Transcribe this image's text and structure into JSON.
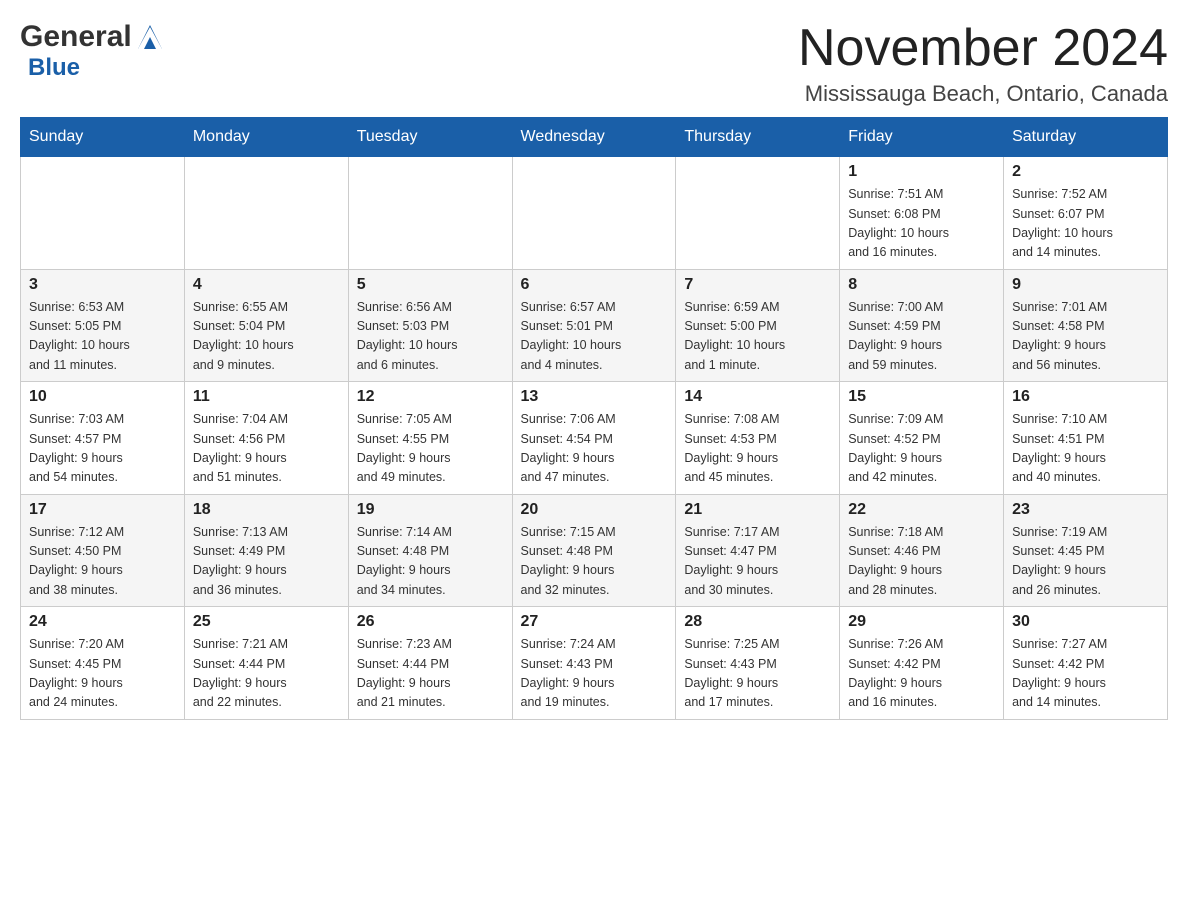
{
  "header": {
    "logo_general": "General",
    "logo_blue": "Blue",
    "month_title": "November 2024",
    "location": "Mississauga Beach, Ontario, Canada"
  },
  "days_of_week": [
    "Sunday",
    "Monday",
    "Tuesday",
    "Wednesday",
    "Thursday",
    "Friday",
    "Saturday"
  ],
  "weeks": [
    [
      {
        "day": "",
        "info": ""
      },
      {
        "day": "",
        "info": ""
      },
      {
        "day": "",
        "info": ""
      },
      {
        "day": "",
        "info": ""
      },
      {
        "day": "",
        "info": ""
      },
      {
        "day": "1",
        "info": "Sunrise: 7:51 AM\nSunset: 6:08 PM\nDaylight: 10 hours\nand 16 minutes."
      },
      {
        "day": "2",
        "info": "Sunrise: 7:52 AM\nSunset: 6:07 PM\nDaylight: 10 hours\nand 14 minutes."
      }
    ],
    [
      {
        "day": "3",
        "info": "Sunrise: 6:53 AM\nSunset: 5:05 PM\nDaylight: 10 hours\nand 11 minutes."
      },
      {
        "day": "4",
        "info": "Sunrise: 6:55 AM\nSunset: 5:04 PM\nDaylight: 10 hours\nand 9 minutes."
      },
      {
        "day": "5",
        "info": "Sunrise: 6:56 AM\nSunset: 5:03 PM\nDaylight: 10 hours\nand 6 minutes."
      },
      {
        "day": "6",
        "info": "Sunrise: 6:57 AM\nSunset: 5:01 PM\nDaylight: 10 hours\nand 4 minutes."
      },
      {
        "day": "7",
        "info": "Sunrise: 6:59 AM\nSunset: 5:00 PM\nDaylight: 10 hours\nand 1 minute."
      },
      {
        "day": "8",
        "info": "Sunrise: 7:00 AM\nSunset: 4:59 PM\nDaylight: 9 hours\nand 59 minutes."
      },
      {
        "day": "9",
        "info": "Sunrise: 7:01 AM\nSunset: 4:58 PM\nDaylight: 9 hours\nand 56 minutes."
      }
    ],
    [
      {
        "day": "10",
        "info": "Sunrise: 7:03 AM\nSunset: 4:57 PM\nDaylight: 9 hours\nand 54 minutes."
      },
      {
        "day": "11",
        "info": "Sunrise: 7:04 AM\nSunset: 4:56 PM\nDaylight: 9 hours\nand 51 minutes."
      },
      {
        "day": "12",
        "info": "Sunrise: 7:05 AM\nSunset: 4:55 PM\nDaylight: 9 hours\nand 49 minutes."
      },
      {
        "day": "13",
        "info": "Sunrise: 7:06 AM\nSunset: 4:54 PM\nDaylight: 9 hours\nand 47 minutes."
      },
      {
        "day": "14",
        "info": "Sunrise: 7:08 AM\nSunset: 4:53 PM\nDaylight: 9 hours\nand 45 minutes."
      },
      {
        "day": "15",
        "info": "Sunrise: 7:09 AM\nSunset: 4:52 PM\nDaylight: 9 hours\nand 42 minutes."
      },
      {
        "day": "16",
        "info": "Sunrise: 7:10 AM\nSunset: 4:51 PM\nDaylight: 9 hours\nand 40 minutes."
      }
    ],
    [
      {
        "day": "17",
        "info": "Sunrise: 7:12 AM\nSunset: 4:50 PM\nDaylight: 9 hours\nand 38 minutes."
      },
      {
        "day": "18",
        "info": "Sunrise: 7:13 AM\nSunset: 4:49 PM\nDaylight: 9 hours\nand 36 minutes."
      },
      {
        "day": "19",
        "info": "Sunrise: 7:14 AM\nSunset: 4:48 PM\nDaylight: 9 hours\nand 34 minutes."
      },
      {
        "day": "20",
        "info": "Sunrise: 7:15 AM\nSunset: 4:48 PM\nDaylight: 9 hours\nand 32 minutes."
      },
      {
        "day": "21",
        "info": "Sunrise: 7:17 AM\nSunset: 4:47 PM\nDaylight: 9 hours\nand 30 minutes."
      },
      {
        "day": "22",
        "info": "Sunrise: 7:18 AM\nSunset: 4:46 PM\nDaylight: 9 hours\nand 28 minutes."
      },
      {
        "day": "23",
        "info": "Sunrise: 7:19 AM\nSunset: 4:45 PM\nDaylight: 9 hours\nand 26 minutes."
      }
    ],
    [
      {
        "day": "24",
        "info": "Sunrise: 7:20 AM\nSunset: 4:45 PM\nDaylight: 9 hours\nand 24 minutes."
      },
      {
        "day": "25",
        "info": "Sunrise: 7:21 AM\nSunset: 4:44 PM\nDaylight: 9 hours\nand 22 minutes."
      },
      {
        "day": "26",
        "info": "Sunrise: 7:23 AM\nSunset: 4:44 PM\nDaylight: 9 hours\nand 21 minutes."
      },
      {
        "day": "27",
        "info": "Sunrise: 7:24 AM\nSunset: 4:43 PM\nDaylight: 9 hours\nand 19 minutes."
      },
      {
        "day": "28",
        "info": "Sunrise: 7:25 AM\nSunset: 4:43 PM\nDaylight: 9 hours\nand 17 minutes."
      },
      {
        "day": "29",
        "info": "Sunrise: 7:26 AM\nSunset: 4:42 PM\nDaylight: 9 hours\nand 16 minutes."
      },
      {
        "day": "30",
        "info": "Sunrise: 7:27 AM\nSunset: 4:42 PM\nDaylight: 9 hours\nand 14 minutes."
      }
    ]
  ]
}
